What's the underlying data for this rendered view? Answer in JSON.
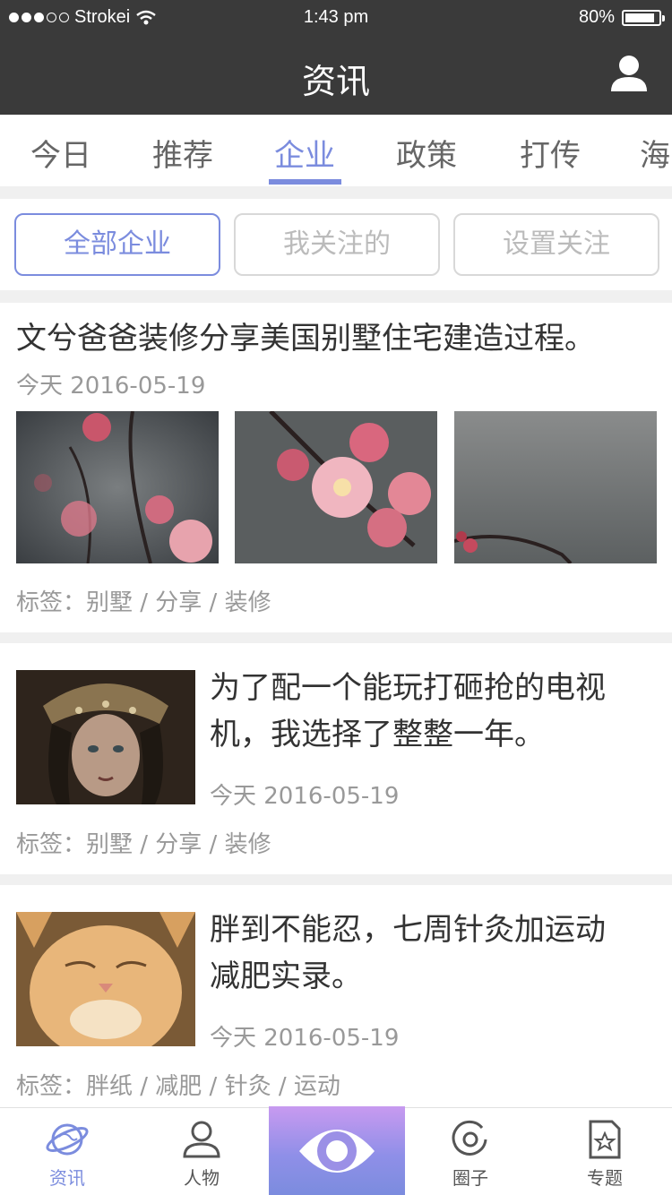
{
  "status_bar": {
    "carrier": "Strokei",
    "time": "1:43 pm",
    "battery": "80%",
    "battery_level": 0.8,
    "signal_bars_filled": 3,
    "signal_bars_total": 5
  },
  "nav": {
    "title": "资讯",
    "user_icon": "user-icon"
  },
  "tabs": [
    {
      "label": "今日"
    },
    {
      "label": "推荐"
    },
    {
      "label": "企业"
    },
    {
      "label": "政策"
    },
    {
      "label": "打传"
    },
    {
      "label": "海"
    }
  ],
  "active_tab": "企业",
  "filters": [
    {
      "label": "全部企业"
    },
    {
      "label": "我关注的"
    },
    {
      "label": "设置关注"
    }
  ],
  "articles": [
    {
      "title": "文兮爸爸装修分享美国别墅住宅建造过程。",
      "date": "今天 2016-05-19",
      "tags": "标签：别墅 / 分享 / 装修"
    },
    {
      "title_line1": "为了配一个能玩打砸抢的电视",
      "title_line2": "机，我选择了整整一年。",
      "date": "今天 2016-05-19",
      "tags": "标签：别墅 / 分享 / 装修"
    },
    {
      "title_line1": "胖到不能忍，七周针灸加运动",
      "title_line2": "减肥实录。",
      "date": "今天 2016-05-19",
      "tags": "标签：胖纸 / 减肥 / 针灸 / 运动"
    }
  ],
  "tabbar": [
    {
      "label": "资讯",
      "icon": "planet-icon"
    },
    {
      "label": "人物",
      "icon": "person-icon"
    },
    {
      "label": "",
      "icon": "eye-icon"
    },
    {
      "label": "圈子",
      "icon": "circle-icon"
    },
    {
      "label": "专题",
      "icon": "star-document-icon"
    }
  ],
  "colors": {
    "accent": "#7b8cde",
    "header": "#3a3a3a",
    "center_gradient_top": "#c89af0",
    "center_gradient_bottom": "#7b8cde"
  }
}
